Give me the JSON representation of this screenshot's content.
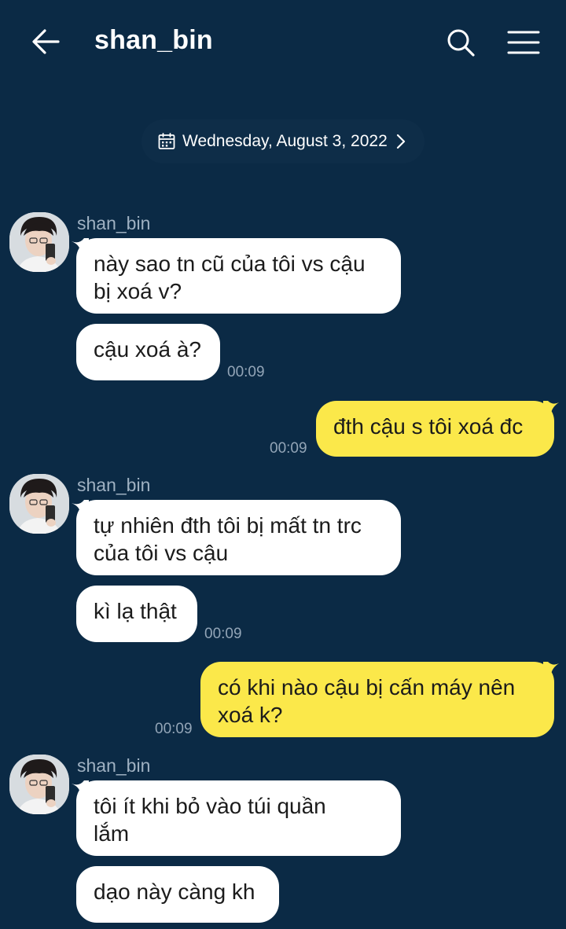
{
  "header": {
    "title": "shan_bin",
    "back_icon": "arrow-left-icon",
    "search_icon": "search-icon",
    "menu_icon": "hamburger-menu-icon"
  },
  "date_divider": {
    "label": "Wednesday, August 3, 2022",
    "icon": "calendar-icon",
    "chevron": "chevron-right-icon"
  },
  "colors": {
    "background": "#0b2a45",
    "incoming_bubble": "#ffffff",
    "outgoing_bubble": "#fbe84a",
    "timestamp": "#93a5b7",
    "sender_name": "#9fb1c2"
  },
  "messages": [
    {
      "sender": "shan_bin",
      "direction": "in",
      "text": "này sao tn cũ của tôi vs cậu\nbị xoá v?",
      "time": ""
    },
    {
      "sender": "shan_bin",
      "direction": "in",
      "text": "cậu xoá à?",
      "time": "00:09"
    },
    {
      "sender": "me",
      "direction": "out",
      "text": "đth cậu s tôi xoá đc",
      "time": "00:09"
    },
    {
      "sender": "shan_bin",
      "direction": "in",
      "text": "tự nhiên đth tôi bị mất tn trc\ncủa tôi vs cậu",
      "time": ""
    },
    {
      "sender": "shan_bin",
      "direction": "in",
      "text": "kì lạ thật",
      "time": "00:09"
    },
    {
      "sender": "me",
      "direction": "out",
      "text": "có khi nào cậu bị cấn máy nên\nxoá k?",
      "time": "00:09"
    },
    {
      "sender": "shan_bin",
      "direction": "in",
      "text": "tôi ít khi bỏ vào túi quần\nlắm",
      "time": ""
    },
    {
      "sender": "shan_bin",
      "direction": "in",
      "text": "dạo này càng kh",
      "time": ""
    }
  ],
  "groups": [
    {
      "sender_label": "shan_bin"
    },
    {
      "sender_label": "shan_bin"
    },
    {
      "sender_label": "shan_bin"
    }
  ]
}
